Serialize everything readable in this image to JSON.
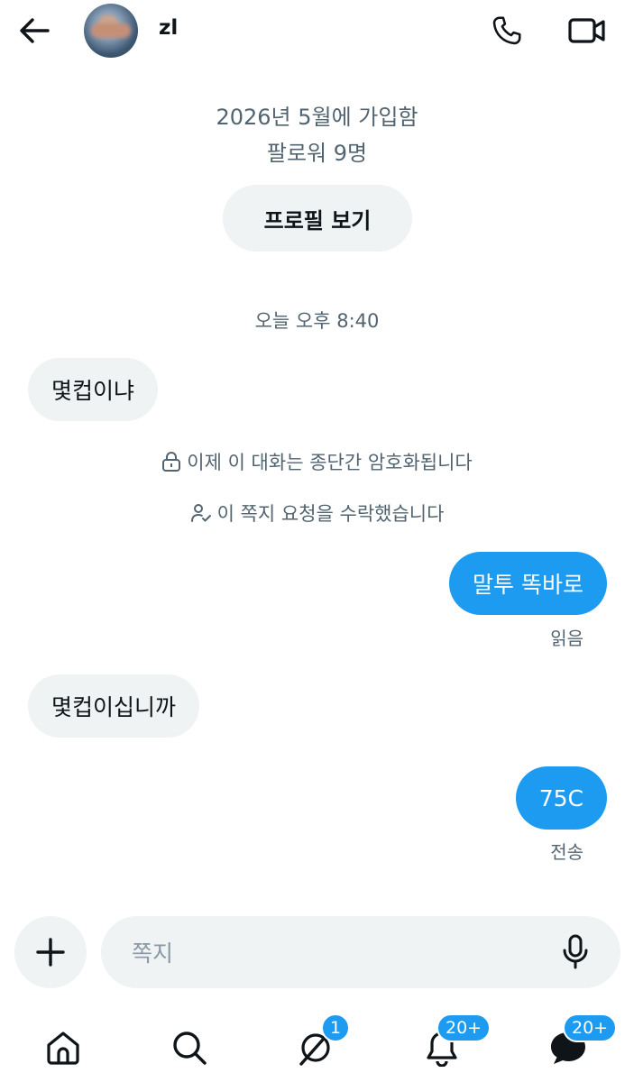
{
  "header": {
    "name": "zl",
    "back_icon": "arrow-left-icon",
    "call_icon": "phone-icon",
    "video_icon": "video-camera-icon"
  },
  "profile": {
    "joined": "2026년 5월에 가입함",
    "followers": "팔로워 9명",
    "view_profile_label": "프로필 보기"
  },
  "conversation": {
    "timestamp": "오늘 오후 8:40",
    "encryption_notice": "이제 이 대화는 종단간 암호화됩니다",
    "request_notice": "이 쪽지 요청을 수락했습니다",
    "messages": [
      {
        "direction": "in",
        "text": "몇컵이냐"
      },
      {
        "direction": "out",
        "text": "말투 똑바로",
        "status": "읽음"
      },
      {
        "direction": "in",
        "text": "몇컵이십니까"
      },
      {
        "direction": "out",
        "text": "75C",
        "status": "전송"
      }
    ]
  },
  "composer": {
    "placeholder": "쪽지",
    "add_icon": "plus-icon",
    "mic_icon": "microphone-icon"
  },
  "tabbar": {
    "items": [
      {
        "icon": "home-icon"
      },
      {
        "icon": "search-icon"
      },
      {
        "icon": "grok-icon",
        "badge": "1"
      },
      {
        "icon": "bell-icon",
        "badge": "20+"
      },
      {
        "icon": "messages-icon",
        "badge": "20+"
      }
    ]
  },
  "colors": {
    "accent": "#1d9bf0",
    "bubble_in": "#eff3f4",
    "muted_text": "#536471"
  }
}
